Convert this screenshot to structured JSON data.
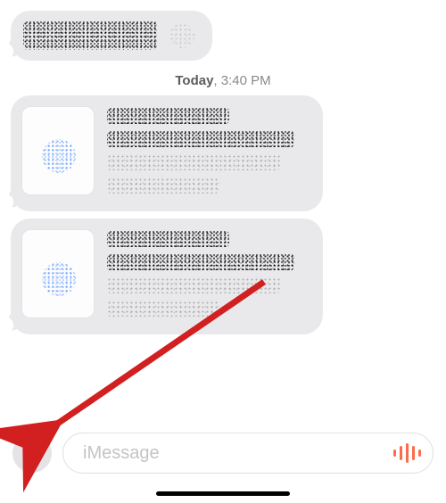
{
  "timestamp": {
    "day": "Today",
    "time": "3:40 PM"
  },
  "composer": {
    "placeholder": "iMessage",
    "value": ""
  },
  "annotation": {
    "arrow_color": "#d21f1f",
    "points_to": "plus-button"
  }
}
